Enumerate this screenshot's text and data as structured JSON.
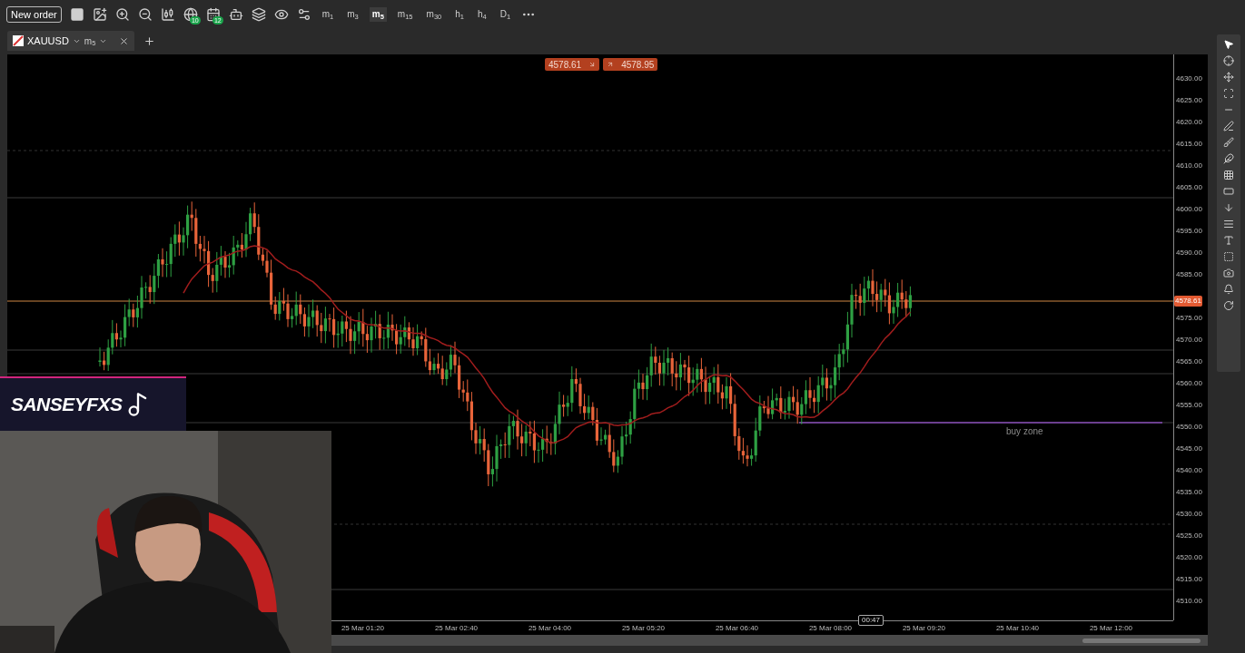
{
  "toolbar": {
    "new_order": "New order",
    "badges": [
      "10",
      "12"
    ],
    "timeframes": [
      {
        "label": "m$_{1}$",
        "selected": false
      },
      {
        "label": "m$_{3}$",
        "selected": false
      },
      {
        "label": "m$_{5}$",
        "selected": true
      },
      {
        "label": "m$_{15}$",
        "selected": false
      },
      {
        "label": "m$_{30}$",
        "selected": false
      },
      {
        "label": "h$_{1}$",
        "selected": false
      },
      {
        "label": "h$_{4}$",
        "selected": false
      },
      {
        "label": "D$_{1}$",
        "selected": false
      }
    ]
  },
  "tab": {
    "symbol": "XAUUSD",
    "timeframe": "m$_{5}$"
  },
  "chart": {
    "price_tags": [
      "4578.61",
      "4578.95"
    ],
    "zone_label": "buy zone",
    "price_axis": [
      {
        "label": "4630.00",
        "kind": "tick"
      },
      {
        "label": "4625.00",
        "kind": "tick"
      },
      {
        "label": "4620.00",
        "kind": "tick"
      },
      {
        "label": "4615.00",
        "kind": "tick"
      },
      {
        "label": "4610.00",
        "kind": "tick"
      },
      {
        "label": "4605.00",
        "kind": "tick"
      },
      {
        "label": "4600.00",
        "kind": "tick"
      },
      {
        "label": "4595.00",
        "kind": "tick"
      },
      {
        "label": "4590.00",
        "kind": "tick"
      },
      {
        "label": "4585.00",
        "kind": "tick"
      },
      {
        "label": "4578.61",
        "kind": "current"
      },
      {
        "label": "4575.00",
        "kind": "tick"
      },
      {
        "label": "4570.00",
        "kind": "tick"
      },
      {
        "label": "4565.00",
        "kind": "tick"
      },
      {
        "label": "4560.00",
        "kind": "tick"
      },
      {
        "label": "4555.00",
        "kind": "tick"
      },
      {
        "label": "4550.00",
        "kind": "tick"
      },
      {
        "label": "4545.00",
        "kind": "tick"
      },
      {
        "label": "4540.00",
        "kind": "tick"
      },
      {
        "label": "4535.00",
        "kind": "tick"
      },
      {
        "label": "4530.00",
        "kind": "tick"
      },
      {
        "label": "4525.00",
        "kind": "tick"
      },
      {
        "label": "4520.00",
        "kind": "tick"
      },
      {
        "label": "4515.00",
        "kind": "tick"
      },
      {
        "label": "4510.00",
        "kind": "tick"
      }
    ],
    "time_axis": [
      "25 Mar 01:20",
      "25 Mar 02:40",
      "25 Mar 04:00",
      "25 Mar 05:20",
      "25 Mar 06:40",
      "25 Mar 08:00",
      "25 Mar 09:20",
      "25 Mar 10:40",
      "25 Mar 12:00"
    ],
    "time_marker": "00:47"
  },
  "stream_overlay": {
    "channel": "SANSEYFXS"
  }
}
